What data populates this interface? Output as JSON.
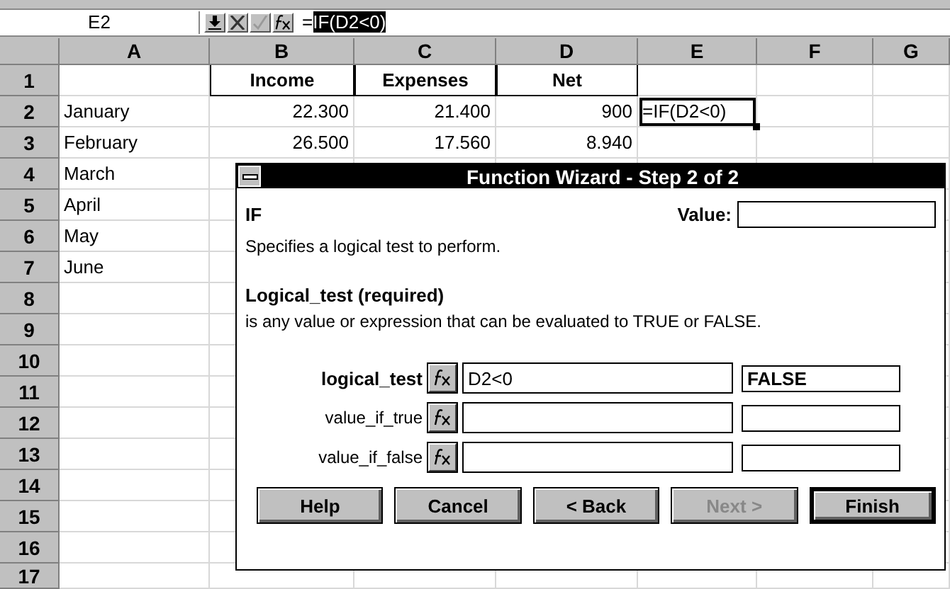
{
  "formula_bar": {
    "name_box": "E2",
    "formula_prefix": "=",
    "formula_selected": "IF(D2<0)"
  },
  "columns": [
    "A",
    "B",
    "C",
    "D",
    "E",
    "F",
    "G"
  ],
  "rows": [
    {
      "header": "1",
      "kind": "heading",
      "cells": [
        "",
        "Income",
        "Expenses",
        "Net",
        "",
        "",
        ""
      ]
    },
    {
      "header": "2",
      "kind": "data",
      "cells": [
        "January",
        "22.300",
        "21.400",
        "900",
        "=IF(D2<0)",
        "",
        ""
      ]
    },
    {
      "header": "3",
      "kind": "data",
      "cells": [
        "February",
        "26.500",
        "17.560",
        "8.940",
        "",
        "",
        ""
      ]
    },
    {
      "header": "4",
      "kind": "data",
      "cells": [
        "March",
        "",
        "",
        "",
        "",
        "",
        ""
      ]
    },
    {
      "header": "5",
      "kind": "data",
      "cells": [
        "April",
        "",
        "",
        "",
        "",
        "",
        ""
      ]
    },
    {
      "header": "6",
      "kind": "data",
      "cells": [
        "May",
        "",
        "",
        "",
        "",
        "",
        ""
      ]
    },
    {
      "header": "7",
      "kind": "data",
      "cells": [
        "June",
        "",
        "",
        "",
        "",
        "",
        ""
      ]
    },
    {
      "header": "8",
      "kind": "data",
      "cells": [
        "",
        "",
        "",
        "",
        "",
        "",
        ""
      ]
    },
    {
      "header": "9",
      "kind": "data",
      "cells": [
        "",
        "",
        "",
        "",
        "",
        "",
        ""
      ]
    },
    {
      "header": "10",
      "kind": "data",
      "cells": [
        "",
        "",
        "",
        "",
        "",
        "",
        ""
      ]
    },
    {
      "header": "11",
      "kind": "data",
      "cells": [
        "",
        "",
        "",
        "",
        "",
        "",
        ""
      ]
    },
    {
      "header": "12",
      "kind": "data",
      "cells": [
        "",
        "",
        "",
        "",
        "",
        "",
        ""
      ]
    },
    {
      "header": "13",
      "kind": "data",
      "cells": [
        "",
        "",
        "",
        "",
        "",
        "",
        ""
      ]
    },
    {
      "header": "14",
      "kind": "data",
      "cells": [
        "",
        "",
        "",
        "",
        "",
        "",
        ""
      ]
    },
    {
      "header": "15",
      "kind": "data",
      "cells": [
        "",
        "",
        "",
        "",
        "",
        "",
        ""
      ]
    },
    {
      "header": "16",
      "kind": "data",
      "cells": [
        "",
        "",
        "",
        "",
        "",
        "",
        ""
      ]
    },
    {
      "header": "17",
      "kind": "data",
      "cells": [
        "",
        "",
        "",
        "",
        "",
        "",
        ""
      ]
    }
  ],
  "dialog": {
    "title": "Function Wizard - Step 2 of 2",
    "function_name": "IF",
    "value_label": "Value:",
    "description": "Specifies a logical test to perform.",
    "argument_title": "Logical_test (required)",
    "argument_help": "is any value or expression that can be evaluated to TRUE or FALSE.",
    "arguments": [
      {
        "label": "logical_test",
        "required": true,
        "value": "D2<0",
        "result": "FALSE"
      },
      {
        "label": "value_if_true",
        "required": false
      },
      {
        "label": "value_if_false",
        "required": false
      }
    ],
    "buttons": [
      {
        "label": "Help",
        "disabled": false,
        "default": false
      },
      {
        "label": "Cancel",
        "disabled": false,
        "default": false
      },
      {
        "label": "< Back",
        "disabled": false,
        "default": false
      },
      {
        "label": "Next >",
        "disabled": true,
        "default": false
      },
      {
        "label": "Finish",
        "disabled": false,
        "default": true
      }
    ]
  }
}
